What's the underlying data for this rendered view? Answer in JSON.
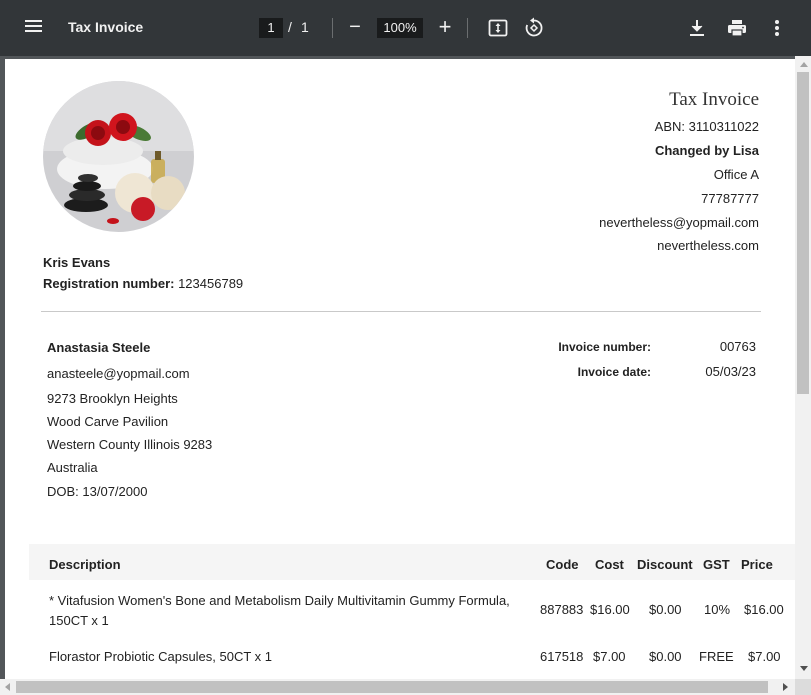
{
  "toolbar": {
    "title": "Tax Invoice",
    "page_current": "1",
    "page_separator": "/",
    "page_total": "1",
    "zoom_out_label": "−",
    "zoom_value": "100%",
    "zoom_in_label": "+",
    "icons": [
      "menu-icon",
      "fit-page-icon",
      "rotate-icon",
      "download-icon",
      "print-icon",
      "more-vert-icon"
    ]
  },
  "seller": {
    "title": "Tax Invoice",
    "abn": "ABN: 3110311022",
    "name": "Changed by Lisa",
    "office": "Office A",
    "phone": "77787777",
    "email": "nevertheless@yopmail.com",
    "website": "nevertheless.com"
  },
  "issuer": {
    "name": "Kris Evans",
    "registration_label": "Registration number:",
    "registration_value": " 123456789"
  },
  "customer": {
    "name": "Anastasia Steele",
    "email": "anasteele@yopmail.com",
    "address1": "9273 Brooklyn Heights",
    "address2": "Wood Carve Pavilion",
    "address3": "Western County Illinois 9283",
    "country": "Australia",
    "dob": "DOB: 13/07/2000"
  },
  "invoice_meta": {
    "number_label": "Invoice number:",
    "number_value": "00763",
    "date_label": "Invoice date:",
    "date_value": "05/03/23"
  },
  "table": {
    "headers": {
      "description": "Description",
      "code": "Code",
      "cost": "Cost",
      "discount": "Discount",
      "gst": "GST",
      "price": "Price"
    },
    "rows": [
      {
        "description_line1": "* Vitafusion Women's Bone and Metabolism Daily Multivitamin Gummy Formula,",
        "description_line2": "150CT x 1",
        "code": "887883",
        "cost": "$16.00",
        "discount": "$0.00",
        "gst": "10%",
        "price": "$16.00"
      },
      {
        "description_line1": "Florastor Probiotic Capsules, 50CT x 1",
        "description_line2": "",
        "code": "617518",
        "cost": "$7.00",
        "discount": "$0.00",
        "gst": "FREE",
        "price": "$7.00"
      }
    ]
  }
}
